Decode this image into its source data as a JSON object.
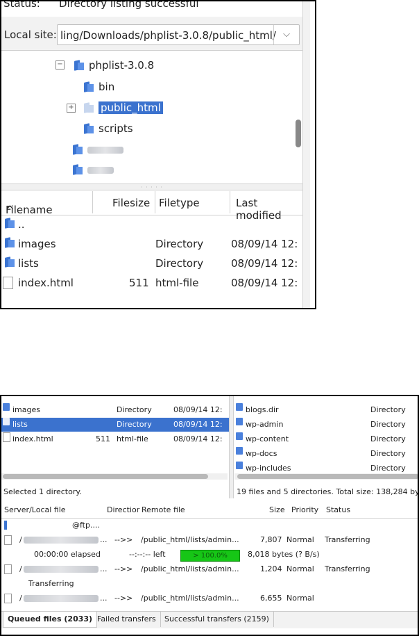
{
  "top": {
    "status_key": "Status:",
    "status_value": "Directory listing successful",
    "local_site_label": "Local site:",
    "local_site_path": "ling/Downloads/phplist-3.0.8/public_html/",
    "tree": [
      {
        "label": "phplist-3.0.8"
      },
      {
        "label": "bin"
      },
      {
        "label": "public_html"
      },
      {
        "label": "scripts"
      }
    ],
    "columns": [
      "Filename",
      "Filesize",
      "Filetype",
      "Last modified"
    ],
    "rows": [
      {
        "name": "..",
        "size": "",
        "type": "",
        "modified": ""
      },
      {
        "name": "images",
        "size": "",
        "type": "Directory",
        "modified": "08/09/14 12:"
      },
      {
        "name": "lists",
        "size": "",
        "type": "Directory",
        "modified": "08/09/14 12:"
      },
      {
        "name": "index.html",
        "size": "511",
        "type": "html-file",
        "modified": "08/09/14 12:"
      }
    ]
  },
  "bottom": {
    "local_rows": [
      {
        "name": "images",
        "type": "Directory",
        "modified": "08/09/14 12:"
      },
      {
        "name": "lists",
        "type": "Directory",
        "modified": "08/09/14 12:"
      },
      {
        "name": "index.html",
        "size": "511",
        "type": "html-file",
        "modified": "08/09/14 12:"
      }
    ],
    "remote_rows": [
      {
        "name": "blogs.dir",
        "type": "Directory"
      },
      {
        "name": "wp-admin",
        "type": "Directory"
      },
      {
        "name": "wp-content",
        "type": "Directory"
      },
      {
        "name": "wp-docs",
        "type": "Directory"
      },
      {
        "name": "wp-includes",
        "type": "Directory"
      }
    ],
    "local_status": "Selected 1 directory.",
    "remote_status": "19 files and 5 directories. Total size: 138,284 by",
    "queue_columns": [
      "Server/Local file",
      "Directior",
      "Remote file",
      "Size",
      "Priority",
      "Status"
    ],
    "server": "@ftp....",
    "queue": [
      {
        "local": "/",
        "dir": "-->>",
        "remote": "/public_html/lists/admin...",
        "size": "7,807",
        "priority": "Normal",
        "status": "Transferring"
      },
      {
        "local": "/",
        "dir": "-->>",
        "remote": "/public_html/lists/admin...",
        "size": "1,204",
        "priority": "Normal",
        "status": "Transferring"
      },
      {
        "local": "/",
        "dir": "-->>",
        "remote": "/public_html/lists/admin...",
        "size": "6,655",
        "priority": "Normal",
        "status": ""
      }
    ],
    "progress": {
      "elapsed": "00:00:00 elapsed",
      "left": "--:--:-- left",
      "percent_label": "> 100.0%",
      "bytes": "8,018 bytes (? B/s)"
    },
    "tabs": [
      "Queued files (2033)",
      "Failed transfers",
      "Successful transfers (2159)"
    ]
  }
}
